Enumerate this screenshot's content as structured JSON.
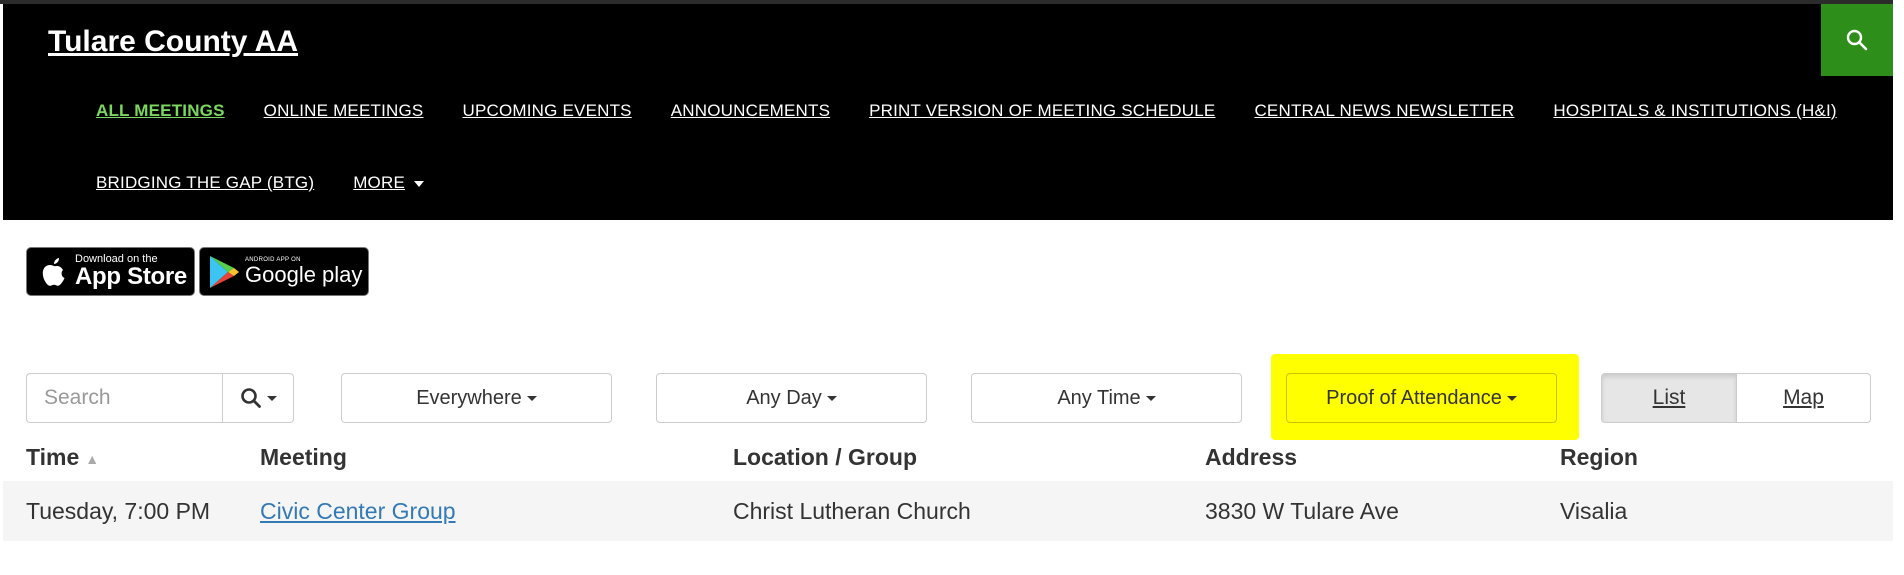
{
  "site": {
    "title": "Tulare County AA"
  },
  "nav": {
    "row1": [
      "ALL MEETINGS",
      "ONLINE MEETINGS",
      "UPCOMING EVENTS",
      "ANNOUNCEMENTS",
      "PRINT VERSION OF MEETING SCHEDULE",
      "CENTRAL NEWS NEWSLETTER",
      "HOSPITALS & INSTITUTIONS (H&I)"
    ],
    "row2": [
      "BRIDGING THE GAP (BTG)",
      "MORE"
    ],
    "active": "ALL MEETINGS"
  },
  "badges": {
    "apple": {
      "small": "Download on the",
      "big": "App Store"
    },
    "google": {
      "small": "ANDROID APP ON",
      "big": "Google play"
    }
  },
  "filters": {
    "search_placeholder": "Search",
    "region": "Everywhere",
    "day": "Any Day",
    "time": "Any Time",
    "type": "Proof of Attendance"
  },
  "view": {
    "list": "List",
    "map": "Map",
    "selected": "List"
  },
  "table": {
    "headers": [
      "Time",
      "Meeting",
      "Location / Group",
      "Address",
      "Region"
    ],
    "rows": [
      {
        "time": "Tuesday, 7:00 PM",
        "meeting": "Civic Center Group",
        "location": "Christ Lutheran Church",
        "address": "3830 W Tulare Ave",
        "region": "Visalia"
      }
    ]
  },
  "colors": {
    "header_bg": "#000000",
    "accent_green": "#2d8f1a",
    "active_nav": "#7cd85c",
    "highlight": "#ffff00",
    "link": "#337ab7"
  }
}
